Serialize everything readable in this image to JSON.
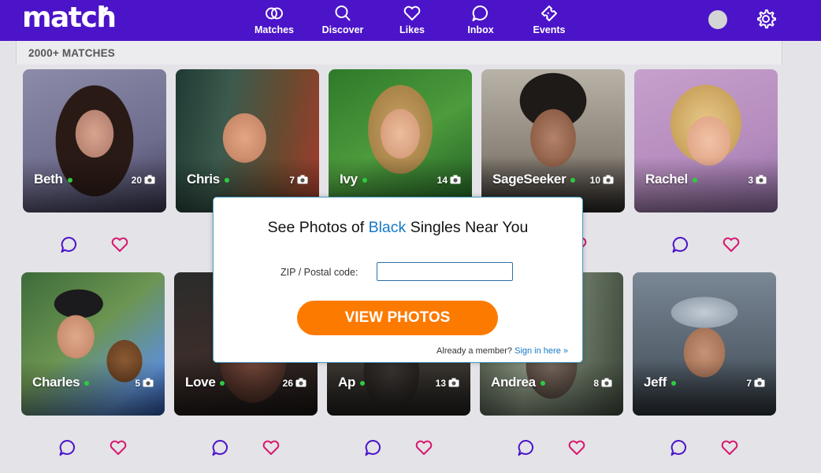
{
  "brand": {
    "logo_text": "match"
  },
  "nav": {
    "items": [
      {
        "label": "Matches",
        "icon": "matches-icon"
      },
      {
        "label": "Discover",
        "icon": "search-icon"
      },
      {
        "label": "Likes",
        "icon": "heart-icon"
      },
      {
        "label": "Inbox",
        "icon": "chat-icon"
      },
      {
        "label": "Events",
        "icon": "ticket-icon"
      }
    ]
  },
  "header": {
    "match_count": "2000+ MATCHES"
  },
  "profiles": [
    {
      "name": "Beth",
      "photos": "20"
    },
    {
      "name": "Chris",
      "photos": "7"
    },
    {
      "name": "Ivy",
      "photos": "14"
    },
    {
      "name": "SageSeeker",
      "photos": "10"
    },
    {
      "name": "Rachel",
      "photos": "3"
    },
    {
      "name": "Charles",
      "photos": "5"
    },
    {
      "name": "Love",
      "photos": "26"
    },
    {
      "name": "Ap",
      "photos": "13"
    },
    {
      "name": "Andrea",
      "photos": "8"
    },
    {
      "name": "Jeff",
      "photos": "7"
    }
  ],
  "modal": {
    "title_pre": "See Photos of ",
    "title_highlight": "Black",
    "title_post": " Singles Near You",
    "zip_label": "ZIP / Postal code:",
    "zip_value": "",
    "cta_label": "VIEW PHOTOS",
    "member_text": "Already a member?",
    "signin_link": "Sign in here »"
  },
  "colors": {
    "brand_purple": "#4b14c8",
    "cta_orange": "#fd7a00",
    "link_blue": "#1479c5",
    "online_green": "#2ecc40",
    "like_pink": "#d6186e",
    "message_purple": "#4b14c8"
  }
}
